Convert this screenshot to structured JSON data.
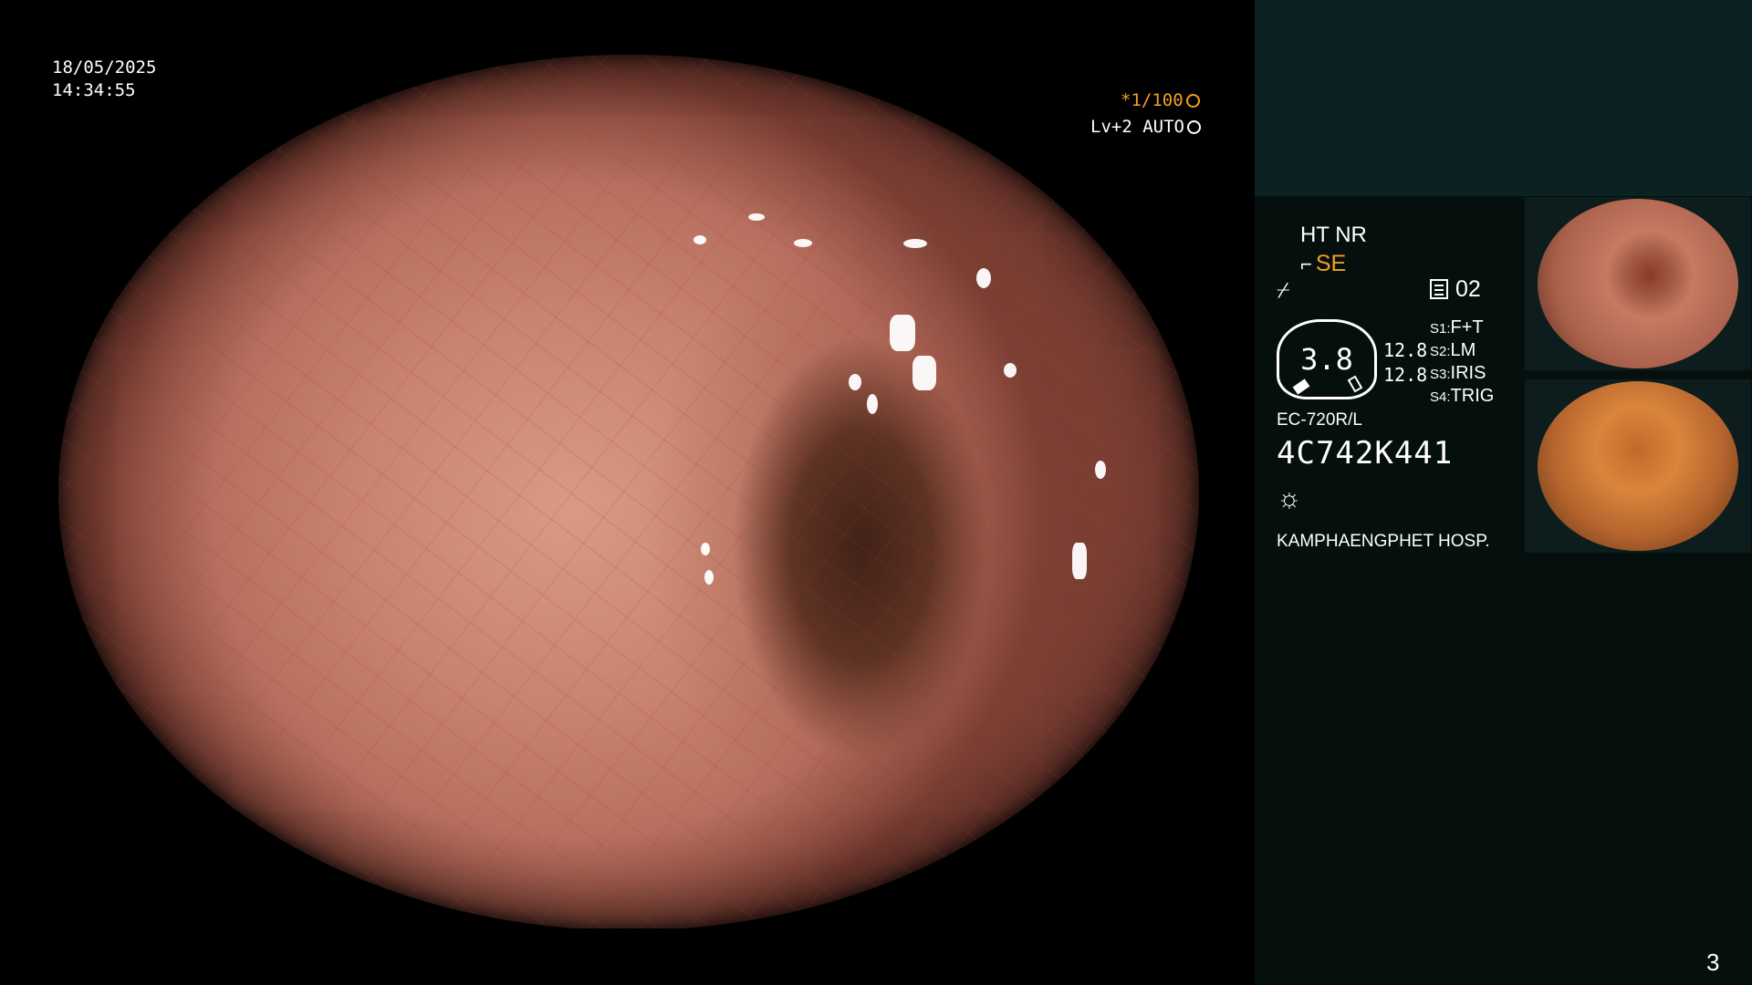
{
  "overlay": {
    "date": "18/05/2025",
    "time": "14:34:55",
    "shutter": "*1/100",
    "level": "Lv+2 AUTO"
  },
  "sidebar": {
    "ht_nr": "HT NR",
    "se": "SE",
    "record_count": "02",
    "gauge_value": "3.8",
    "val_1": "12.8",
    "val_2": "12.8",
    "switches": [
      {
        "key": "S1",
        "value": "F+T"
      },
      {
        "key": "S2",
        "value": "LM"
      },
      {
        "key": "S3",
        "value": "IRIS"
      },
      {
        "key": "S4",
        "value": "TRIG"
      }
    ],
    "model": "EC-720R/L",
    "serial": "4C742K441",
    "hospital": "KAMPHAENGPHET HOSP.",
    "page_number": "3"
  },
  "icons": {
    "shutter": "aperture-icon",
    "level": "auto-iris-icon",
    "se": "structure-enhance-icon",
    "filter": "filter-icon",
    "record": "record-list-icon",
    "light": "light-source-icon"
  },
  "colors": {
    "accent": "#f0a020",
    "sidebar_bg": "#050f0d",
    "sidebar_top": "#0c2222"
  }
}
